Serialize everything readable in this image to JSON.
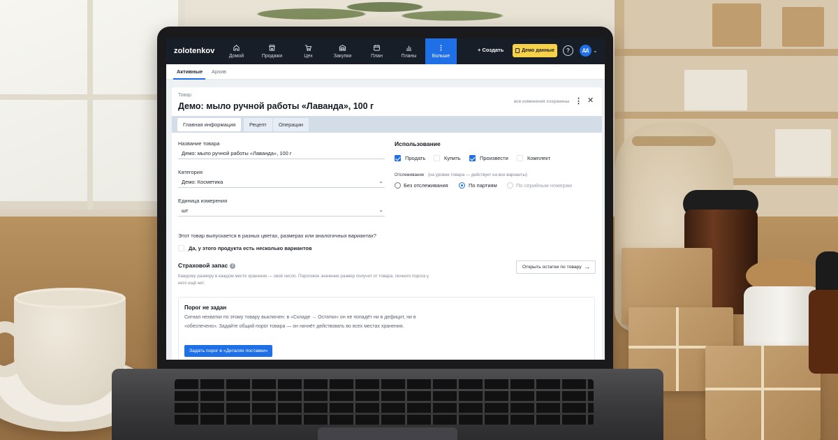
{
  "app": {
    "brand": "zolotenkov",
    "nav": [
      {
        "label": "Домой",
        "icon": "home-icon"
      },
      {
        "label": "Продажи",
        "icon": "store-icon"
      },
      {
        "label": "Цех",
        "icon": "cart-icon"
      },
      {
        "label": "Закупки",
        "icon": "warehouse-icon"
      },
      {
        "label": "План",
        "icon": "calendar-icon"
      },
      {
        "label": "Планы",
        "icon": "chart-icon"
      },
      {
        "label": "Больше",
        "icon": "more-vertical-icon",
        "active": true
      }
    ],
    "create_label": "+ Создать",
    "demo_label": "Демо данные",
    "help_label": "?",
    "avatar_initials": "ДД",
    "accent_color": "#1f6fe6",
    "demo_color": "#f6d24a"
  },
  "subtabs": {
    "active": "Активные",
    "archive": "Архив"
  },
  "product": {
    "kicker": "Товар",
    "title": "Демо: мыло ручной работы «Лаванда», 100 г",
    "saved_note": "все изменения сохранены",
    "tabs": [
      "Главная информация",
      "Рецепт",
      "Операции"
    ],
    "active_tab": "Главная информация",
    "fields": {
      "name_label": "Название товара",
      "name_value": "Демо: мыло ручной работы «Лаванда», 100 г",
      "category_label": "Категория",
      "category_value": "Демо: Косметика",
      "unit_label": "Единица измерения",
      "unit_value": "шт"
    },
    "variants": {
      "question": "Этот товар выпускается в разных цветах, размерах или аналогичных вариантах?",
      "checkbox_label": "Да, у этого продукта есть несколько вариантов",
      "checked": false
    },
    "usage": {
      "heading": "Использование",
      "options": [
        {
          "label": "Продать",
          "checked": true
        },
        {
          "label": "Купить",
          "checked": false
        },
        {
          "label": "Произвести",
          "checked": true
        },
        {
          "label": "Комплект",
          "checked": false
        }
      ],
      "tracking_label": "Отслеживание",
      "tracking_note": "(на уровне товара — действует на все варианты)",
      "tracking_options": [
        {
          "label": "Без отслеживания",
          "selected": false,
          "disabled": false
        },
        {
          "label": "По партиям",
          "selected": true,
          "disabled": false
        },
        {
          "label": "По серийным номерам",
          "selected": false,
          "disabled": true
        }
      ]
    },
    "safety_stock": {
      "heading": "Страховой запас",
      "description": "Каждому размеру в каждом месте хранения — своё число. Пороговое значение размер получит от товара, личного порога у него ещё нет.",
      "open_button": "Открыть остатки по товару",
      "alert_title": "Порог не задан",
      "alert_body": "Сигнал нехватки по этому товару выключен: в «Складе → Остатки» он не попадёт ни в дефицит, ни в «обеспечено». Задайте общий порог товара — он начнёт действовать во всех местах хранения.",
      "alert_button": "Задать порог в «Деталях поставки»"
    }
  }
}
